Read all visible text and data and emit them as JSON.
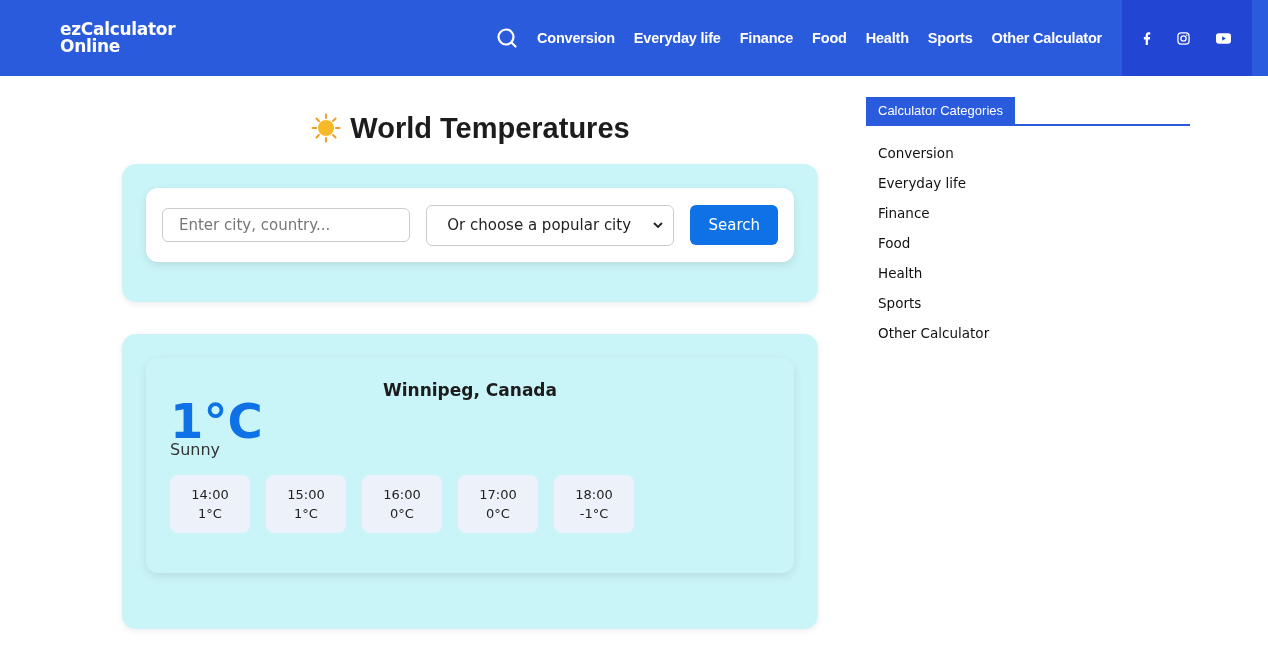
{
  "header": {
    "logo": [
      "ezCalculator",
      "Online"
    ],
    "nav": [
      "Conversion",
      "Everyday life",
      "Finance",
      "Food",
      "Health",
      "Sports",
      "Other Calculator"
    ]
  },
  "title": "World Temperatures",
  "search": {
    "placeholder": "Enter city, country...",
    "select": "Or choose a popular city",
    "button": "Search"
  },
  "weather": {
    "location": "Winnipeg, Canada",
    "temperature": "1°C",
    "condition": "Sunny",
    "hourly": [
      {
        "time": "14:00",
        "temp": "1°C"
      },
      {
        "time": "15:00",
        "temp": "1°C"
      },
      {
        "time": "16:00",
        "temp": "0°C"
      },
      {
        "time": "17:00",
        "temp": "0°C"
      },
      {
        "time": "18:00",
        "temp": "-1°C"
      }
    ]
  },
  "sidebar": {
    "heading": "Calculator Categories",
    "items": [
      "Conversion",
      "Everyday life",
      "Finance",
      "Food",
      "Health",
      "Sports",
      "Other Calculator"
    ]
  }
}
